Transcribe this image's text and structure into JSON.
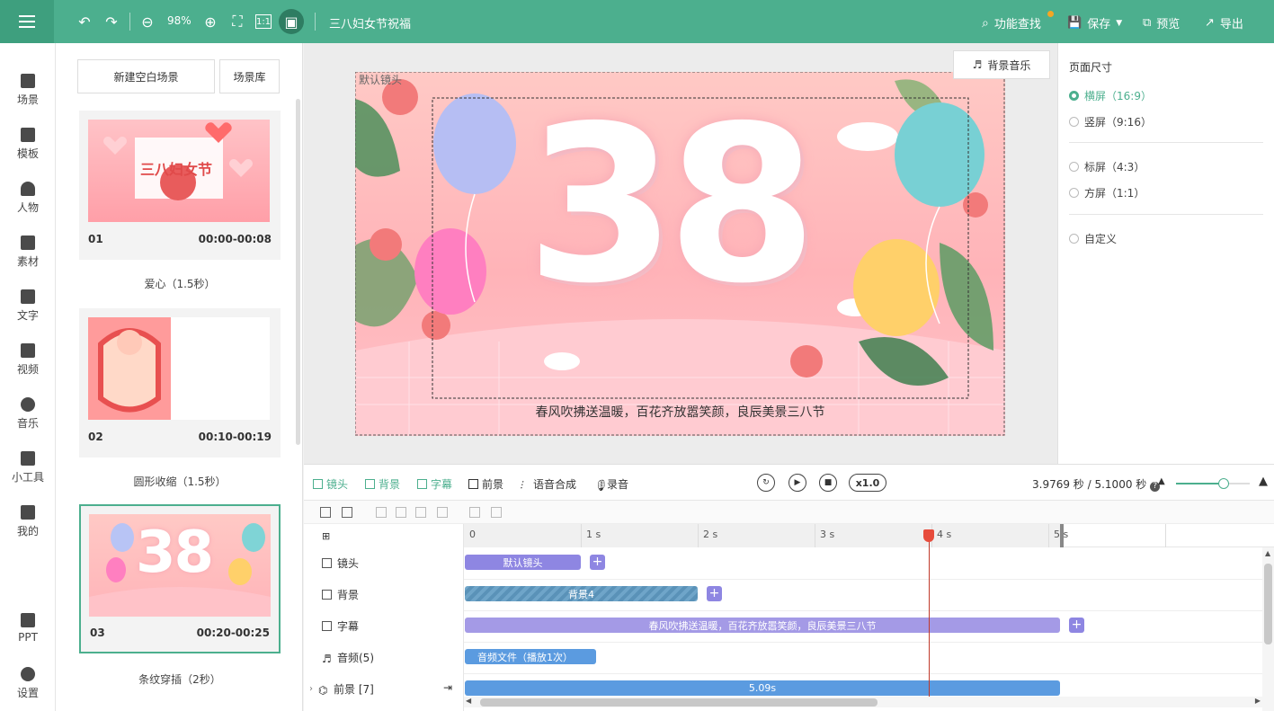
{
  "topbar": {
    "zoom": "98%",
    "title": "三八妇女节祝福",
    "find_label": "功能查找",
    "save_label": "保存",
    "preview_label": "预览",
    "export_label": "导出"
  },
  "sidebar": {
    "items": [
      {
        "label": "场景"
      },
      {
        "label": "模板"
      },
      {
        "label": "人物"
      },
      {
        "label": "素材"
      },
      {
        "label": "文字"
      },
      {
        "label": "视频"
      },
      {
        "label": "音乐"
      },
      {
        "label": "小工具"
      },
      {
        "label": "我的"
      },
      {
        "label": "PPT"
      },
      {
        "label": "设置"
      }
    ]
  },
  "scenes": {
    "new_blank_label": "新建空白场景",
    "library_label": "场景库",
    "items": [
      {
        "num": "01",
        "time": "00:00-00:08",
        "name": "爱心（1.5秒）",
        "thumb_text": "三八妇女节"
      },
      {
        "num": "02",
        "time": "00:10-00:19",
        "name": "圆形收缩（1.5秒）"
      },
      {
        "num": "03",
        "time": "00:20-00:25",
        "name": "条纹穿插（2秒）",
        "thumb_text": "38"
      }
    ]
  },
  "canvas": {
    "camera_label": "默认镜头",
    "big_text": "38",
    "caption": "春风吹拂送温暖，百花齐放嚣笑颜，良辰美景三八节",
    "music_label": "背景音乐"
  },
  "settings": {
    "title": "页面尺寸",
    "options": [
      {
        "label": "横屏（16:9）",
        "selected": true
      },
      {
        "label": "竖屏（9:16）",
        "selected": false
      },
      {
        "label": "标屏（4:3）",
        "selected": false
      },
      {
        "label": "方屏（1:1）",
        "selected": false
      },
      {
        "label": "自定义",
        "selected": false
      }
    ]
  },
  "timeline": {
    "tabs": [
      {
        "label": "镜头"
      },
      {
        "label": "背景"
      },
      {
        "label": "字幕"
      },
      {
        "label": "前景"
      },
      {
        "label": "语音合成"
      },
      {
        "label": "录音"
      }
    ],
    "speed": "x1.0",
    "time_readout": "3.9769 秒 / 5.1000 秒",
    "ruler_labels": [
      "0",
      "1 s",
      "2 s",
      "3 s",
      "4 s",
      "5 s"
    ],
    "tracks": [
      {
        "label": "镜头"
      },
      {
        "label": "背景"
      },
      {
        "label": "字幕"
      },
      {
        "label": "音频(5)"
      },
      {
        "label": "前景 [7]"
      }
    ],
    "clips": {
      "camera": "默认镜头",
      "background": "背景4",
      "subtitle": "春风吹拂送温暖，百花齐放嚣笑颜，良辰美景三八节",
      "audio": "音频文件（播放1次）",
      "foreground": "5.09s"
    },
    "zoom_level": 0.65
  },
  "colors": {
    "accent": "#4caf8e",
    "clip_purple": "#8e86e2",
    "clip_blue": "#5b9be0",
    "playhead": "#c0392b"
  }
}
